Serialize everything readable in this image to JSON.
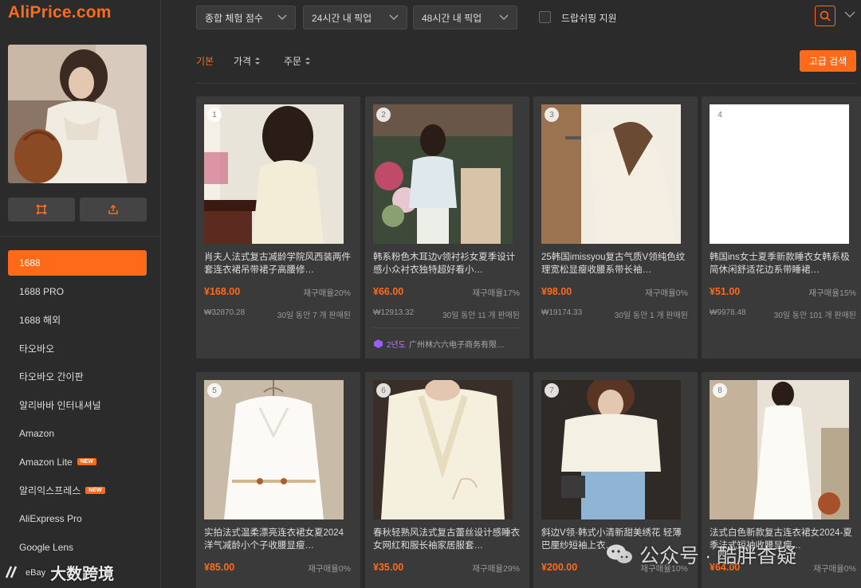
{
  "logo": "AliPrice.com",
  "sidebar": {
    "sources": [
      {
        "label": "1688",
        "active": true
      },
      {
        "label": "1688 PRO"
      },
      {
        "label": "1688 해외"
      },
      {
        "label": "타오바오"
      },
      {
        "label": "타오바오 간이판"
      },
      {
        "label": "알리바바 인터내셔널"
      },
      {
        "label": "Amazon"
      },
      {
        "label": "Amazon Lite",
        "badge": "NEW"
      },
      {
        "label": "알리익스프레스",
        "badge": "NEW"
      },
      {
        "label": "AliExpress Pro"
      },
      {
        "label": "Google Lens"
      }
    ]
  },
  "filters": {
    "experience": "종합 체험 점수",
    "pickup24": "24시간 내 픽업",
    "pickup48": "48시간 내 픽업",
    "dropship": "드랍쉬핑 지원"
  },
  "sort": {
    "basic": "기본",
    "price": "가격",
    "order": "주문",
    "advanced": "고급 검색"
  },
  "products": [
    {
      "num": "1",
      "title": "肖夫人法式复古减龄学院风西装两件套连衣裙吊带裙子高腰修…",
      "price": "¥168.00",
      "repurchase": "재구매율20%",
      "krw": "₩32870.28",
      "sold": "30일 동안 7 개 판매된"
    },
    {
      "num": "2",
      "title": "韩系粉色木耳边v领衬衫女夏季设计感小众衬衣独特超好看小…",
      "price": "¥66.00",
      "repurchase": "재구매율17%",
      "krw": "₩12913.32",
      "sold": "30일 동안 11 개 판매된",
      "supplier_year": "2년도",
      "supplier": "广州林六六电子商务有限…"
    },
    {
      "num": "3",
      "title": "25韩国imissyou复古气质V领纯色纹理宽松显瘦收腰系带长袖…",
      "price": "¥98.00",
      "repurchase": "재구매율0%",
      "krw": "₩19174.33",
      "sold": "30일 동안 1 개 판매된"
    },
    {
      "num": "4",
      "title": "韩国ins女士夏季新款睡衣女韩系极简休闲舒适花边系带睡裙…",
      "price": "¥51.00",
      "repurchase": "재구매율15%",
      "krw": "₩9978.48",
      "sold": "30일 동안 101 개 판매된"
    },
    {
      "num": "5",
      "title": "实拍法式温柔漂亮连衣裙女夏2024洋气减龄小个子收腰显瘦…",
      "price": "¥85.00",
      "repurchase": "재구매율0%"
    },
    {
      "num": "6",
      "title": "春秋轻熟风法式复古蕾丝设计感睡衣女网红和服长袖家居服套…",
      "price": "¥35.00",
      "repurchase": "재구매율29%"
    },
    {
      "num": "7",
      "title": "斜边V领·韩式小清新甜美绣花 轻薄巴厘纱短袖上衣…",
      "price": "¥200.00",
      "repurchase": "재구매율10%"
    },
    {
      "num": "8",
      "title": "法式白色新款复古连衣裙女2024-夏季法式短袖收腰显瘦…",
      "price": "¥64.00",
      "repurchase": "재구매율0%"
    }
  ],
  "watermark_left": "大数跨境",
  "watermark_left_small": "eBay",
  "watermark_right": "公众号 · 酷胖杳疑"
}
